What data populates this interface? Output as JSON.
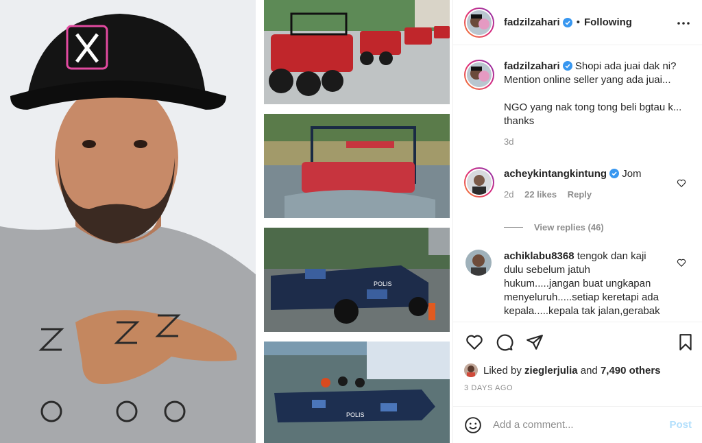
{
  "post": {
    "author": "fadzilzahari",
    "follow_status": "Following",
    "separator": "•"
  },
  "caption": {
    "username": "fadzilzahari",
    "text_line1": "Shopi ada juai dak ni?",
    "text_line2": "Mention online seller yang ada juai...",
    "text_line3": "NGO yang nak tong tong beli bgtau k...",
    "text_line4": "thanks",
    "age": "3d"
  },
  "comments": [
    {
      "username": "acheykintangkintung",
      "text": "Jom",
      "age": "2d",
      "likes": "22 likes",
      "reply_label": "Reply",
      "view_replies": "View replies (46)"
    },
    {
      "username": "achiklabu8368",
      "text_line1": "tengok dan kaji",
      "text_line2": "dulu sebelum jatuh",
      "text_line3": "hukum.....jangan buat ungkapan",
      "text_line4": "menyeluruh.....setiap keretapi ada",
      "text_line5": "kepala.....kepala tak jalan,gerabak"
    }
  ],
  "likes": {
    "prefix": "Liked by",
    "user": "zieglerjulia",
    "joiner": "and",
    "others": "7,490 others"
  },
  "timestamp": "3 DAYS AGO",
  "composer": {
    "placeholder": "Add a comment...",
    "post_label": "Post"
  },
  "media": {
    "police_label_1": "POLIS",
    "police_label_2": "POLIS"
  },
  "colors": {
    "verified": "#3897f0",
    "post_button_disabled": "#b2dffc",
    "muted": "#8e8e8e",
    "text": "#262626"
  },
  "icons": [
    "heart-icon",
    "comment-icon",
    "share-icon",
    "bookmark-icon",
    "more-icon",
    "emoji-icon",
    "verified-icon"
  ]
}
